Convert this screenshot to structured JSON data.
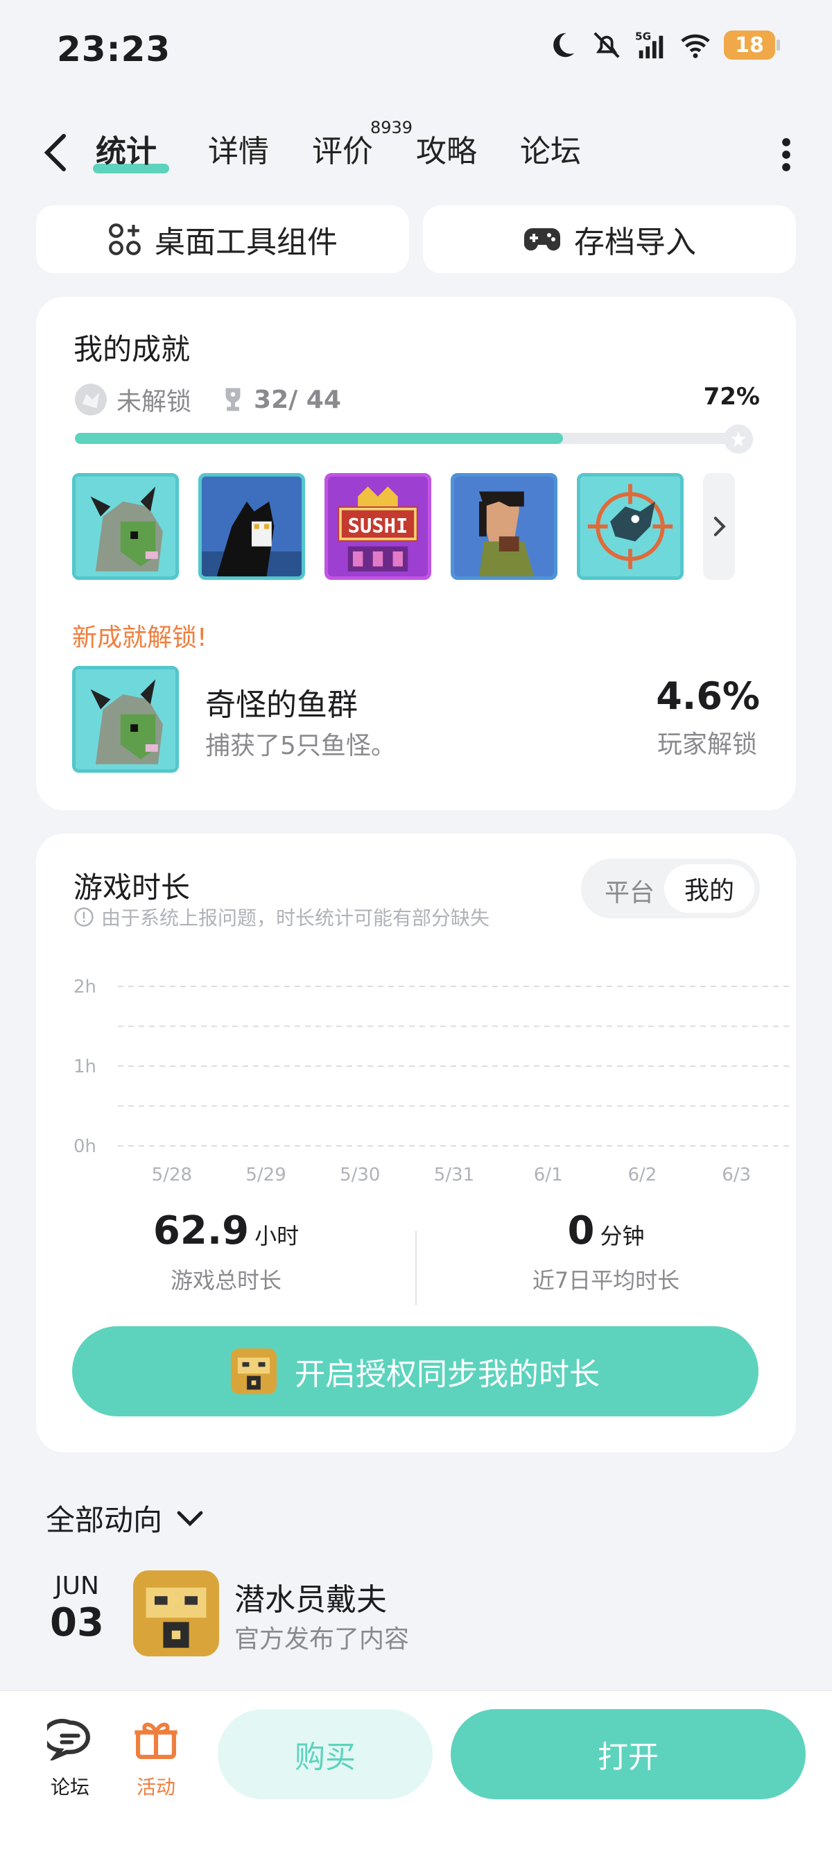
{
  "status_bar": {
    "time": "23:23",
    "network": "5G",
    "battery": "18"
  },
  "nav": {
    "tabs": [
      "统计",
      "详情",
      "评价",
      "攻略",
      "论坛"
    ],
    "active_tab": "统计",
    "reviews_count": "8939"
  },
  "tools": {
    "widget_label": "桌面工具组件",
    "import_label": "存档导入"
  },
  "achievements": {
    "title": "我的成就",
    "locked_label": "未解锁",
    "count": "32/ 44",
    "percent_label": "72%",
    "progress": 0.72,
    "new_unlock_label": "新成就解锁!",
    "new_name": "奇怪的鱼群",
    "new_desc": "捕获了5只鱼怪。",
    "new_percent": "4.6%",
    "new_percent_label": "玩家解锁",
    "sushi_text": "SUSHI"
  },
  "playtime": {
    "title": "游戏时长",
    "notice": "由于系统上报问题，时长统计可能有部分缺失",
    "segment_options": [
      "平台",
      "我的"
    ],
    "segment_selected": "我的",
    "total_value": "62.9",
    "total_unit": "小时",
    "total_label": "游戏总时长",
    "avg_value": "0",
    "avg_unit": "分钟",
    "avg_label": "近7日平均时长",
    "sync_label": "开启授权同步我的时长"
  },
  "chart_data": {
    "type": "bar",
    "categories": [
      "5/28",
      "5/29",
      "5/30",
      "5/31",
      "6/1",
      "6/2",
      "6/3"
    ],
    "values": [
      0,
      0,
      0,
      0,
      0,
      0,
      0
    ],
    "y_ticks": [
      "2h",
      "1h",
      "0h"
    ],
    "ylim": [
      0,
      2
    ],
    "grid": true
  },
  "feed": {
    "title": "全部动向",
    "month": "JUN",
    "day": "03",
    "name": "潜水员戴夫",
    "subtitle": "官方发布了内容"
  },
  "bottom_bar": {
    "forum_label": "论坛",
    "activity_label": "活动",
    "buy_label": "购买",
    "open_label": "打开"
  },
  "colors": {
    "accent": "#5dd3bd",
    "orange": "#ef7f3e",
    "battery": "#f0a848"
  }
}
